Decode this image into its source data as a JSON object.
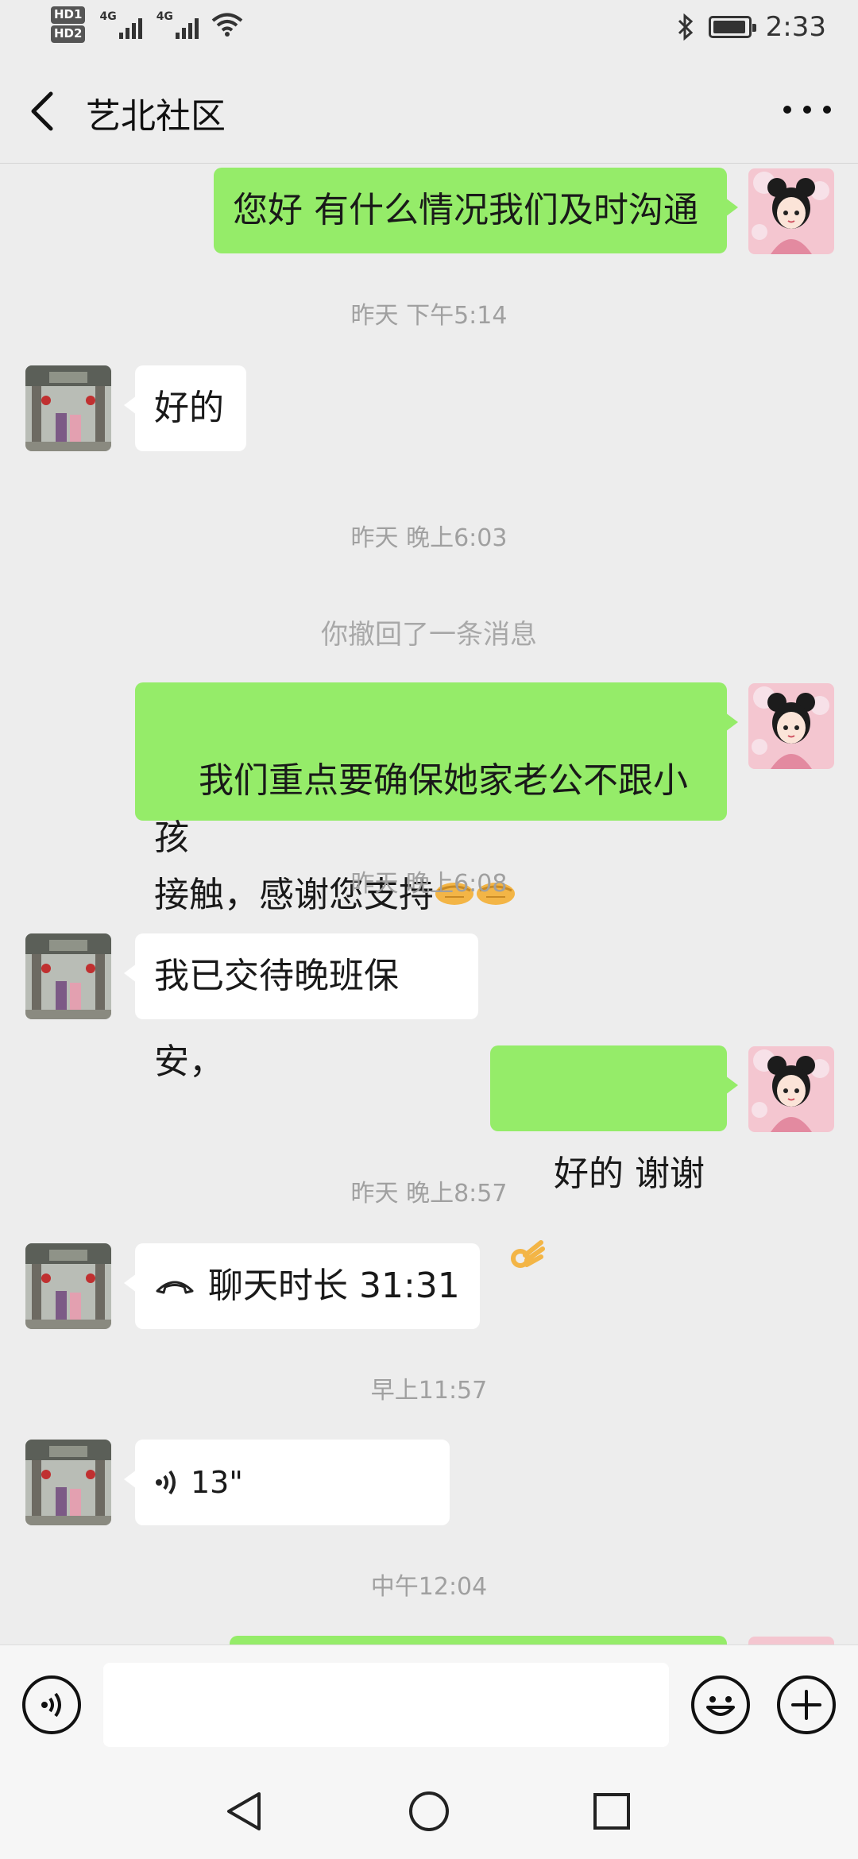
{
  "status_bar": {
    "hd1": "HD1",
    "hd2": "HD2",
    "net1": "4G",
    "net2": "4G",
    "time": "2:33",
    "battery_level": 0.95
  },
  "header": {
    "title": "艺北社区"
  },
  "messages": [
    {
      "type": "text",
      "side": "me",
      "text": "您好 有什么情况我们及时沟通"
    },
    {
      "type": "time",
      "text": "昨天 下午5:14"
    },
    {
      "type": "text",
      "side": "other",
      "text": "好的"
    },
    {
      "type": "time",
      "text": "昨天 晚上6:03"
    },
    {
      "type": "recall",
      "text": "你撤回了一条消息"
    },
    {
      "type": "text",
      "side": "me",
      "text": "我们重点要确保她家老公不跟小孩\n接触，感谢您支持"
    },
    {
      "type": "time",
      "text": "昨天 晚上6:08"
    },
    {
      "type": "text",
      "side": "other",
      "text": "我已交待晚班保安，"
    },
    {
      "type": "text",
      "side": "me",
      "text": "好的 谢谢"
    },
    {
      "type": "time",
      "text": "昨天 晚上8:57"
    },
    {
      "type": "call",
      "side": "other",
      "text": "聊天时长 31:31"
    },
    {
      "type": "time",
      "text": "早上11:57"
    },
    {
      "type": "voice",
      "side": "other",
      "text": "13\""
    },
    {
      "type": "time",
      "text": "中午12:04"
    }
  ],
  "icons": {
    "back": "chevron-left-icon",
    "more": "more-dots-icon",
    "voice_input": "voice-icon",
    "emoji": "emoji-icon",
    "add": "plus-icon",
    "handshake": "handshake-emoji",
    "ok_hand": "ok-hand-emoji"
  },
  "colors": {
    "background": "#ededed",
    "my_bubble": "#95ec69",
    "other_bubble": "#ffffff",
    "timestamp": "#a0a0a0"
  }
}
